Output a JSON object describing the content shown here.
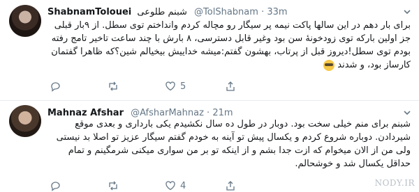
{
  "tweets": [
    {
      "name": "ShabnamTolouei",
      "name_fa": "شبنم طلوعی",
      "handle": "@TolShabnam",
      "time": "33m",
      "body": "برای بار دهم در این سالها پاکت نیمه پر سیگار رو مچاله کردم وانداختم توی سطل. از ۹بار قبلی جز اولین بارکه توی زودخونهٔ سن بود وغیر قابل دسترسی، ۸ بارش با چند ساعت تاخیر تامج رفته بودم توی سطل!دیروز قبل از پرتاب، بهشون گفتم:میشه خداییش بیخیالم شین؟که ظاهرا گفتمان کارساز بود، و شدند",
      "emoji": "sunglasses-emoji",
      "actions": {
        "reply": "",
        "retweet": "",
        "likes": "5"
      }
    },
    {
      "name": "Mahnaz Afshar",
      "handle": "@AfsharMahnaz",
      "time": "21m",
      "body": "شبنم برای منم خیلی سخت بود. دوبار در طول ده سال نکشیدم یکی بارداری و بعدی موقع شیردادن. دوباره شروع کردم و یکسال پیش تو آینه به خودم گفتم سیگار عزیز تو اصلا بد نیستی ولی من از الان میخوام که ازت جدا بشم و از اینکه تو بر من سواری میکنی شرمگینم و تمام حداقل یکسال شد و خوشحالم.",
      "actions": {
        "reply": "",
        "retweet": "",
        "likes": "4"
      }
    }
  ],
  "watermark": "NODY.IR",
  "colors": {
    "text": "#14171a",
    "muted": "#657786",
    "divider": "#e6ecf0"
  }
}
